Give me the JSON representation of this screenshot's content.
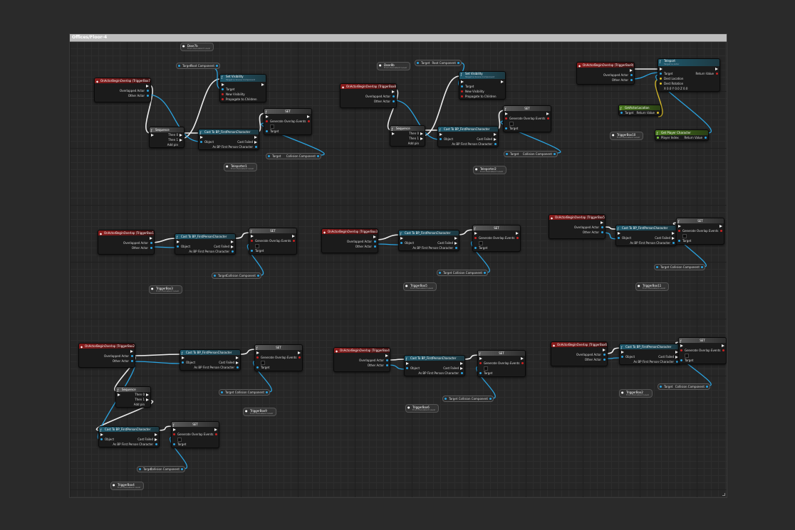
{
  "graph": {
    "tab_title": "Offices/Floor-4",
    "labels": {
      "on_begin_overlap": "OnActorBeginOverlap",
      "overlapped_actor": "Overlapped Actor",
      "other_actor": "Other Actor",
      "set_visibility": "Set Visibility",
      "target_scene_component": "Target is Scene Component",
      "target": "Target",
      "new_visibility": "New Visibility",
      "propagate_to_children": "Propagate to Children",
      "sequence": "Sequence",
      "then0": "Then 0",
      "then1": "Then 1",
      "add_pin": "Add pin",
      "cast": "Cast To BP_FirstPersonCharacter",
      "object": "Object",
      "cast_failed": "Cast Failed",
      "as_bp": "As BP First Person Character",
      "set": "SET",
      "generate_overlap": "Generate Overlap Events",
      "collision_component": "Collision Component",
      "root_component": "Root Component",
      "from_persistent": "From Persistent Level",
      "teleport": "Teleport",
      "target_actor": "Target is Actor",
      "return_value": "Return Value",
      "dest_location": "Dest Location",
      "dest_rotation": "Dest Rotation",
      "get_actor_location": "GetActorLocation",
      "get_player_character": "Get Player Character",
      "player_index": "Player Index",
      "rotation_values": "X 0.0  Y 0.0  Z 0.0",
      "player_index_value": "0"
    },
    "events": [
      "OnActorBeginOverlap (TriggerBox7)",
      "OnActorBeginOverlap (TriggerBox8)",
      "OnActorBeginOverlap (TriggerBox9)",
      "OnActorBeginOverlap (TriggerBox10)",
      "OnActorBeginOverlap (TriggerBox3)",
      "OnActorBeginOverlap (TriggerBox5)",
      "OnActorBeginOverlap (TriggerBox2)",
      "OnActorBeginOverlap (TriggerBox4)",
      "OnActorBeginOverlap (TriggerBox6)"
    ],
    "variables": [
      "Door7b",
      "Teleporter1",
      "Door8b",
      "Teleporter2",
      "TriggerBox10",
      "TriggerBox3",
      "TriggerBox5",
      "TriggerBox11",
      "TriggerBox9",
      "TriggerBox6",
      "TriggerBox2",
      "TriggerBox4",
      "TriggerBox8"
    ],
    "colors": {
      "exec": "#eeeeee",
      "object_pin": "#2aa3e0",
      "vector_pin": "#e0c22a",
      "event_header": "#8a1c1c",
      "function_header": "#1f5a6e"
    }
  }
}
